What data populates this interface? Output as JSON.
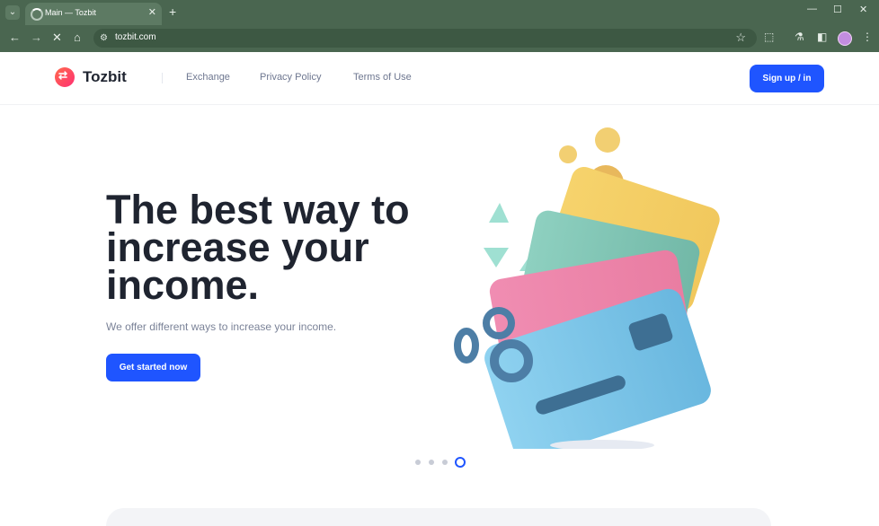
{
  "browser": {
    "tab_title": "Main — Tozbit",
    "url": "tozbit.com",
    "new_tab_label": "+",
    "window_controls": [
      "—",
      "☐",
      "✕"
    ]
  },
  "site": {
    "brand": "Tozbit",
    "nav": [
      "Exchange",
      "Privacy Policy",
      "Terms of Use"
    ],
    "signup": "Sign up / in"
  },
  "hero": {
    "headline_lines": [
      "The best way to",
      "increase your",
      "income."
    ],
    "subtext": "We offer different ways to increase your income.",
    "cta": "Get started now"
  },
  "carousel": {
    "dots_count": 4,
    "active_index": 3
  },
  "colors": {
    "accent": "#1f55ff",
    "browser": "#4a6650"
  }
}
